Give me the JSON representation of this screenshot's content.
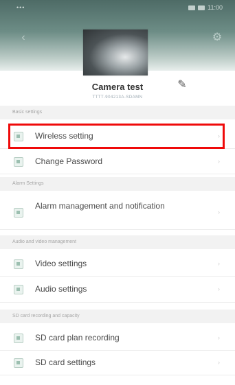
{
  "status_bar": {
    "left_text": "•••",
    "right_text": "11:00"
  },
  "camera": {
    "name": "Camera test",
    "id": "TTTT-904213A-SDAMN"
  },
  "sections": [
    {
      "title": "Basic settings",
      "items": [
        {
          "label": "Wireless setting",
          "icon": "wifi-icon"
        },
        {
          "label": "Change Password",
          "icon": "lock-icon"
        }
      ]
    },
    {
      "title": "Alarm Settings",
      "items": [
        {
          "label": "Alarm management and notification",
          "icon": "alarm-icon"
        }
      ]
    },
    {
      "title": "Audio and video management",
      "items": [
        {
          "label": "Video settings",
          "icon": "video-icon"
        },
        {
          "label": "Audio settings",
          "icon": "audio-icon"
        }
      ]
    },
    {
      "title": "SD card recording and capacity",
      "items": [
        {
          "label": "SD card plan recording",
          "icon": "calendar-icon"
        },
        {
          "label": "SD card settings",
          "icon": "sd-card-icon"
        }
      ]
    }
  ],
  "highlight_color": "#ef0a0a",
  "accent": "#6d8d86"
}
